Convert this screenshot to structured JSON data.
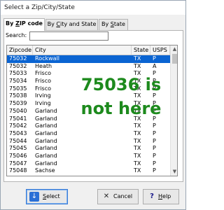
{
  "window": {
    "title": "Select a Zip/City/State"
  },
  "tabs": [
    {
      "label_pre": "By ",
      "label_u": "Z",
      "label_post": "IP code",
      "active": true
    },
    {
      "label_pre": "By ",
      "label_u": "C",
      "label_post": "ity and State",
      "active": false
    },
    {
      "label_pre": "By ",
      "label_u": "S",
      "label_post": "tate",
      "active": false
    }
  ],
  "search": {
    "label": "Search:",
    "value": "",
    "placeholder": ""
  },
  "grid": {
    "columns": [
      "Zipcode",
      "City",
      "State",
      "USPS"
    ],
    "rows": [
      {
        "zip": "75032",
        "city": "Rockwall",
        "state": "TX",
        "usps": "P",
        "selected": true
      },
      {
        "zip": "75032",
        "city": "Heath",
        "state": "TX",
        "usps": "A"
      },
      {
        "zip": "75033",
        "city": "Frisco",
        "state": "TX",
        "usps": "P"
      },
      {
        "zip": "75034",
        "city": "Frisco",
        "state": "TX",
        "usps": "P"
      },
      {
        "zip": "75035",
        "city": "Frisco",
        "state": "TX",
        "usps": "P"
      },
      {
        "zip": "75038",
        "city": "Irving",
        "state": "TX",
        "usps": "P"
      },
      {
        "zip": "75039",
        "city": "Irving",
        "state": "TX",
        "usps": "P"
      },
      {
        "zip": "75040",
        "city": "Garland",
        "state": "TX",
        "usps": "P"
      },
      {
        "zip": "75041",
        "city": "Garland",
        "state": "TX",
        "usps": "P"
      },
      {
        "zip": "75042",
        "city": "Garland",
        "state": "TX",
        "usps": "P"
      },
      {
        "zip": "75043",
        "city": "Garland",
        "state": "TX",
        "usps": "P"
      },
      {
        "zip": "75044",
        "city": "Garland",
        "state": "TX",
        "usps": "P"
      },
      {
        "zip": "75045",
        "city": "Garland",
        "state": "TX",
        "usps": "P"
      },
      {
        "zip": "75046",
        "city": "Garland",
        "state": "TX",
        "usps": "P"
      },
      {
        "zip": "75047",
        "city": "Garland",
        "state": "TX",
        "usps": "P"
      },
      {
        "zip": "75048",
        "city": "Sachse",
        "state": "TX",
        "usps": "P"
      }
    ]
  },
  "overlay": {
    "line1": "75036 is",
    "line2": "not here"
  },
  "buttons": {
    "select": {
      "label_u": "S",
      "label_post": "elect",
      "icon": "select-arrow-icon"
    },
    "cancel": {
      "label": "Cancel",
      "icon": "close-icon"
    },
    "help": {
      "label_u": "H",
      "label_post": "elp",
      "icon": "question-icon"
    }
  },
  "colors": {
    "selection": "#0a64d2",
    "overlay_text": "#1d8a1d"
  }
}
